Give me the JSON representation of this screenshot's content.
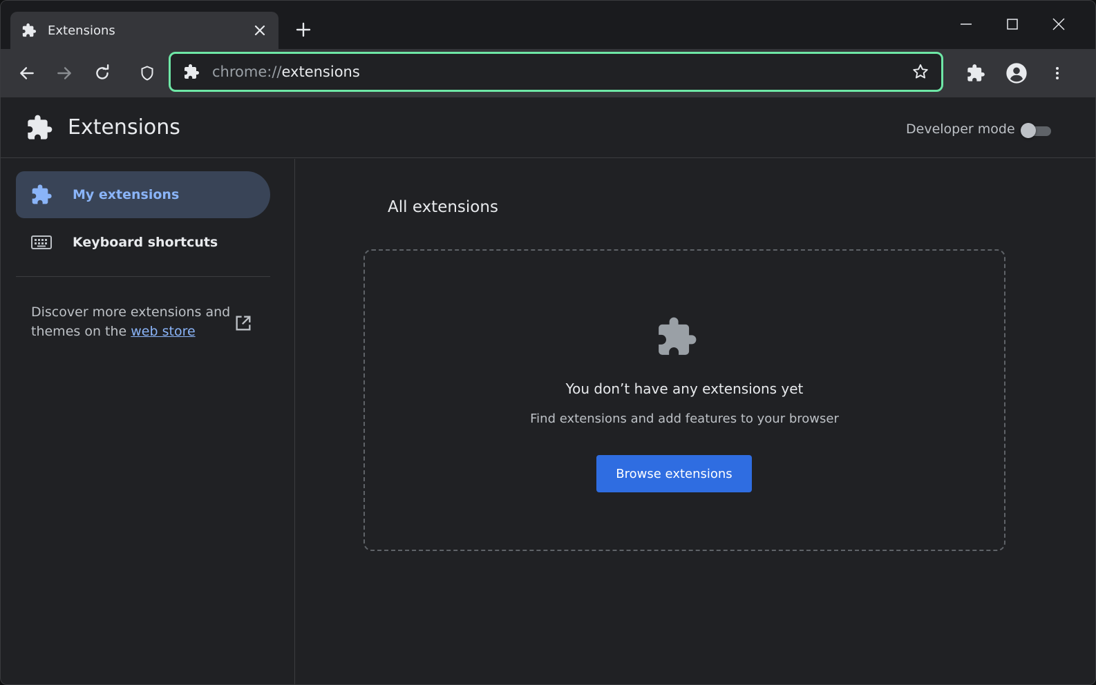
{
  "tab": {
    "title": "Extensions",
    "close_icon": "close-icon"
  },
  "toolbar": {
    "url_scheme": "chrome://",
    "url_path": "extensions",
    "omnibox_focus_color": "#6ee7a6"
  },
  "header": {
    "title": "Extensions",
    "developer_mode_label": "Developer mode",
    "developer_mode_on": false
  },
  "sidebar": {
    "items": [
      {
        "label": "My extensions",
        "icon": "puzzle-icon",
        "active": true
      },
      {
        "label": "Keyboard shortcuts",
        "icon": "keyboard-icon",
        "active": false
      }
    ],
    "discover_text": "Discover more extensions and themes on the",
    "discover_link": "web store"
  },
  "main": {
    "section_title": "All extensions",
    "empty_title": "You don’t have any extensions yet",
    "empty_subtitle": "Find extensions and add features to your browser",
    "browse_button": "Browse extensions"
  },
  "colors": {
    "accent": "#8ab4f8",
    "button": "#2f6de1",
    "active_nav_bg": "#394457",
    "page_bg": "#202124"
  }
}
